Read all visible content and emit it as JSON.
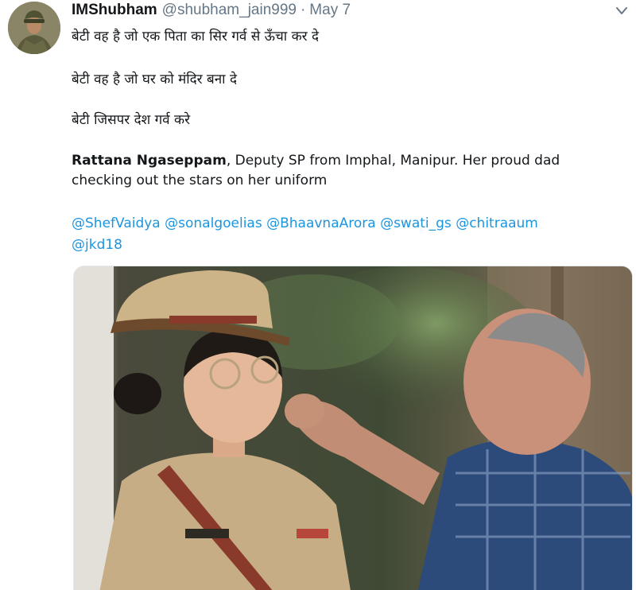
{
  "tweet": {
    "display_name": "IMShubham",
    "handle": "@shubham_jain999",
    "separator": "·",
    "date": "May 7",
    "lines": [
      "बेटी वह है जो एक पिता का सिर गर्व से ऊँचा कर दे",
      "बेटी वह है जो घर को मंदिर बना दे",
      "बेटी जिसपर देश गर्व करे"
    ],
    "bold_name": "Rattana Ngaseppam",
    "description_rest": ", Deputy SP from Imphal, Manipur. Her proud dad checking out the stars on her uniform",
    "mentions": [
      "@ShefVaidya",
      "@sonalgoelias",
      "@BhaavnaArora",
      "@swati_gs",
      "@chitraaum",
      "@jkd18"
    ]
  },
  "icons": {
    "avatar": "soldier-avatar",
    "more": "chevron-down-icon"
  },
  "colors": {
    "text": "#14171a",
    "secondary": "#657786",
    "link": "#1b95e0"
  }
}
